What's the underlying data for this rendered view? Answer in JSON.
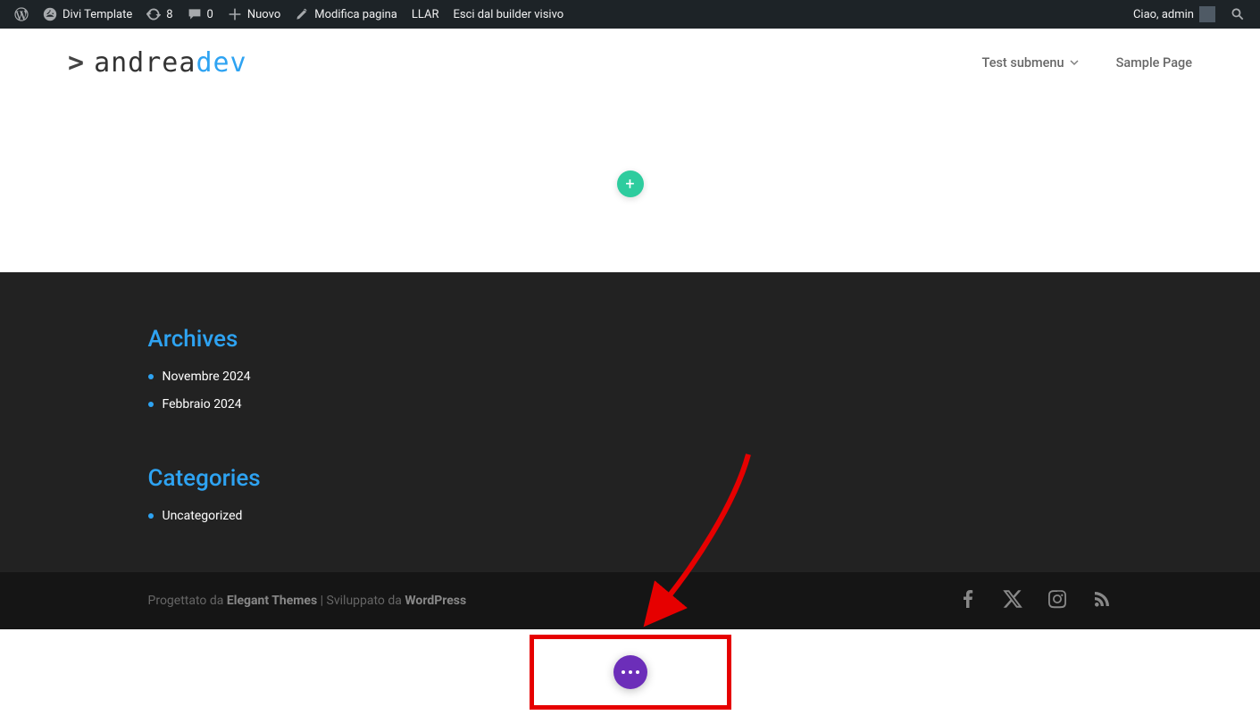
{
  "adminbar": {
    "site_title": "Divi Template",
    "updates_count": "8",
    "comments_count": "0",
    "new_label": "Nuovo",
    "edit_label": "Modifica pagina",
    "llar_label": "LLAR",
    "exit_builder_label": "Esci dal builder visivo",
    "greeting": "Ciao, admin"
  },
  "logo": {
    "prompt": ">",
    "part1": "andrea",
    "part2": "dev"
  },
  "nav": {
    "item1": "Test submenu",
    "item2": "Sample Page"
  },
  "builder": {
    "add_label": "+"
  },
  "widgets": {
    "archives_title": "Archives",
    "archives_items": {
      "0": "Novembre 2024",
      "1": "Febbraio 2024"
    },
    "categories_title": "Categories",
    "categories_items": {
      "0": "Uncategorized"
    }
  },
  "footer": {
    "designed_by_prefix": "Progettato da ",
    "designed_by_name": "Elegant Themes",
    "powered_by_sep": " | Sviluppato da ",
    "powered_by_name": "WordPress"
  }
}
